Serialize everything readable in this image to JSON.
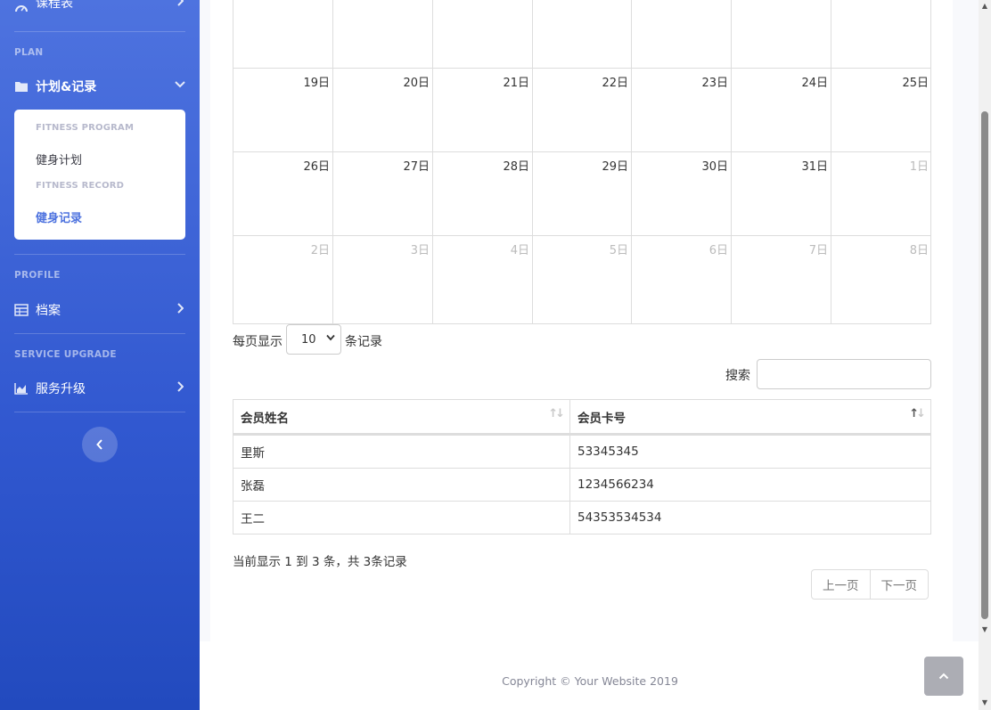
{
  "sidebar": {
    "top_item": {
      "label": "课程表"
    },
    "plan": {
      "heading": "PLAN",
      "item_label": "计划&记录",
      "sub": {
        "program_header": "FITNESS PROGRAM",
        "program_link": "健身计划",
        "record_header": "FITNESS RECORD",
        "record_link": "健身记录"
      }
    },
    "profile": {
      "heading": "PROFILE",
      "item_label": "档案"
    },
    "upgrade": {
      "heading": "SERVICE UPGRADE",
      "item_label": "服务升级"
    },
    "colors": {
      "gradient_top": "#4e73df",
      "gradient_bottom": "#224abe",
      "active_link": "#4e73df"
    }
  },
  "calendar": {
    "rows": [
      {
        "days": [
          "",
          "",
          "",
          "",
          "",
          "",
          ""
        ],
        "other": [
          false,
          false,
          false,
          false,
          false,
          false,
          false
        ]
      },
      {
        "days": [
          "19日",
          "20日",
          "21日",
          "22日",
          "23日",
          "24日",
          "25日"
        ],
        "other": [
          false,
          false,
          false,
          false,
          false,
          false,
          false
        ]
      },
      {
        "days": [
          "26日",
          "27日",
          "28日",
          "29日",
          "30日",
          "31日",
          "1日"
        ],
        "other": [
          false,
          false,
          false,
          false,
          false,
          false,
          true
        ]
      },
      {
        "days": [
          "2日",
          "3日",
          "4日",
          "5日",
          "6日",
          "7日",
          "8日"
        ],
        "other": [
          true,
          true,
          true,
          true,
          true,
          true,
          true
        ]
      }
    ]
  },
  "table_controls": {
    "length_prefix": "每页显示",
    "length_value": "10",
    "length_suffix": "条记录",
    "search_label": "搜索",
    "search_value": ""
  },
  "table": {
    "headers": [
      "会员姓名",
      "会员卡号"
    ],
    "rows": [
      [
        "里斯",
        "53345345"
      ],
      [
        "张磊",
        "1234566234"
      ],
      [
        "王二",
        "54353534534"
      ]
    ]
  },
  "info": "当前显示 1 到 3 条，共 3条记录",
  "pagination": {
    "prev": "上一页",
    "next": "下一页"
  },
  "footer": {
    "copyright": "Copyright © Your Website 2019"
  }
}
